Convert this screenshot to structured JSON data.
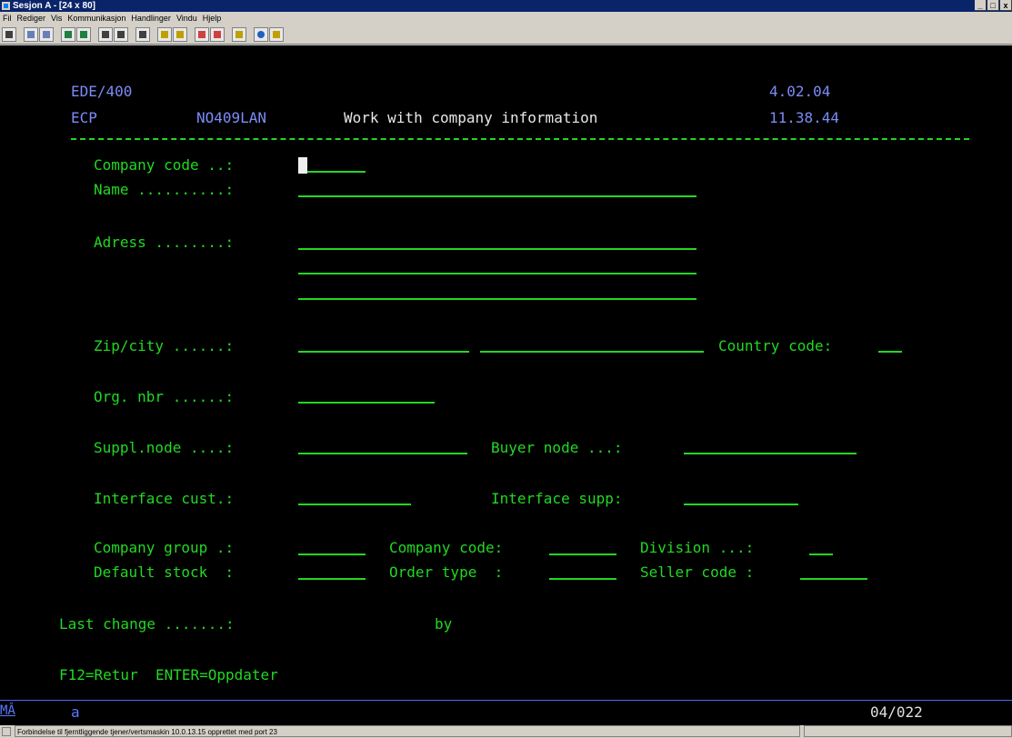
{
  "window": {
    "title": "Sesjon A - [24 x 80]",
    "min_label": "_",
    "max_label": "□",
    "close_label": "x"
  },
  "menu": [
    "Fil",
    "Rediger",
    "Vis",
    "Kommunikasjon",
    "Handlinger",
    "Vindu",
    "Hjelp"
  ],
  "screen": {
    "system": "EDE/400",
    "version": "4.02.04",
    "library": "ECP",
    "user": "NO409LAN",
    "title": "Work with company information",
    "time": "11.38.44",
    "labels": {
      "company_code": "Company code ..:",
      "name": "Name ..........:",
      "adress": "Adress ........:",
      "zip_city": "Zip/city ......:",
      "country_code": "Country code:",
      "org_nbr": "Org. nbr ......:",
      "suppl_node": "Suppl.node ....:",
      "buyer_node": "Buyer node ...:",
      "interface_cust": "Interface cust.:",
      "interface_supp": "Interface supp:",
      "company_group": "Company group .:",
      "company_code2": "Company code:",
      "division": "Division ...:",
      "default_stock": "Default stock  :",
      "order_type": "Order type  :",
      "seller_code": "Seller code :",
      "last_change": "Last change .......:",
      "by": "by"
    },
    "function_keys": "F12=Retur  ENTER=Oppdater"
  },
  "oia": {
    "mode": "MÂ",
    "input": "a",
    "cursor_pos": "04/022"
  },
  "status": {
    "message": "Forbindelse til fjerntliggende tjener/vertsmaskin 10.0.13.15 opprettet med port 23"
  },
  "colors": {
    "terminal_bg": "#000000",
    "field_green": "#22d822",
    "header_blue": "#7d8cf6",
    "titlebar": "#0a246a"
  }
}
